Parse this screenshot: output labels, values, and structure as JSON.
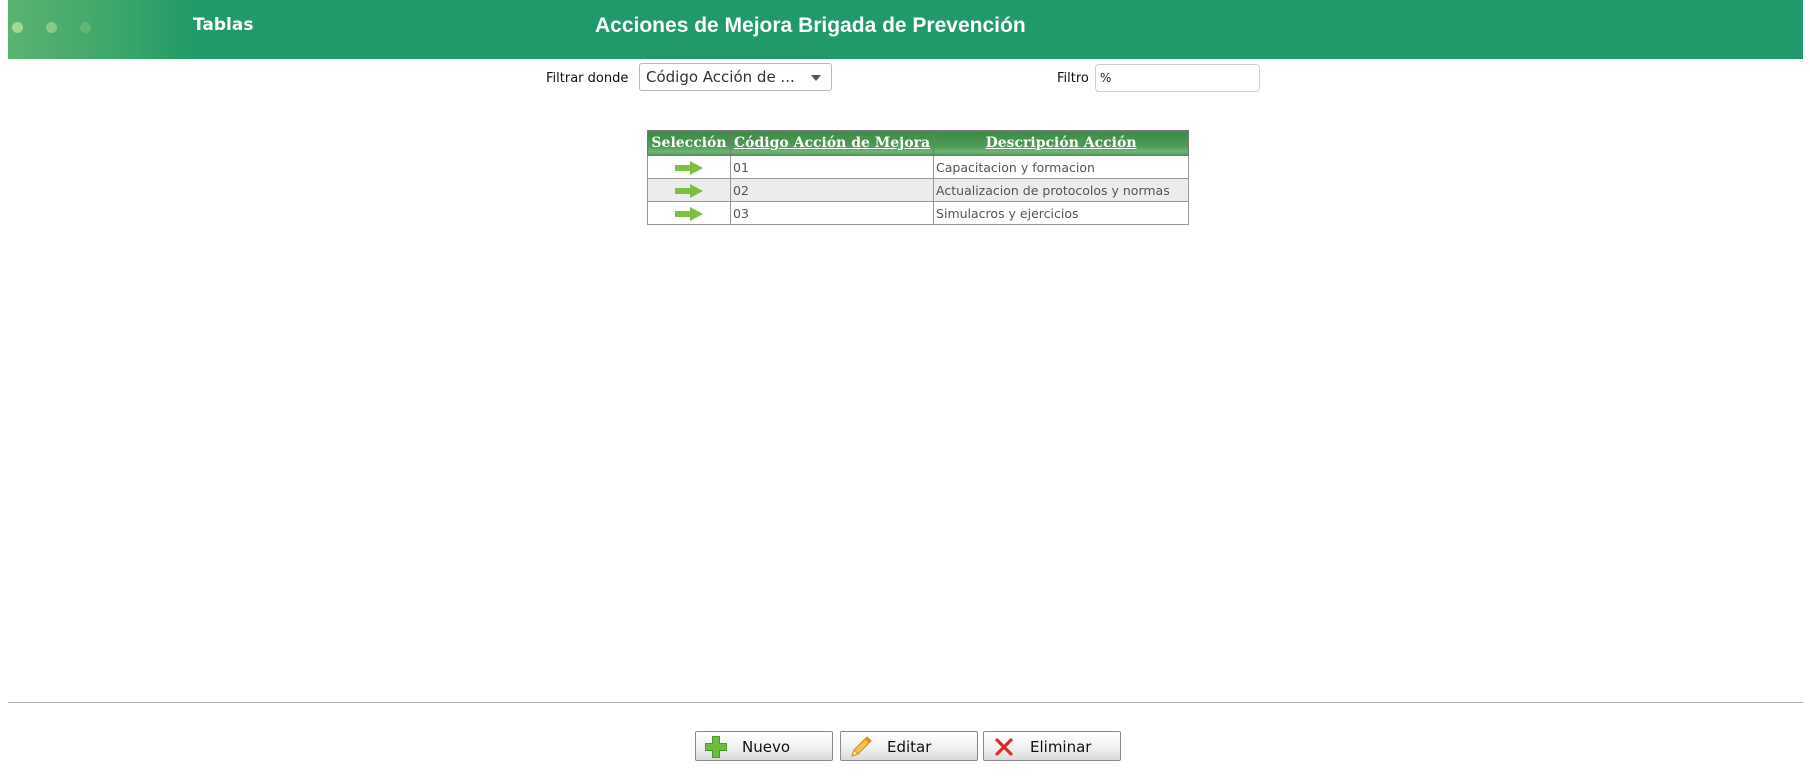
{
  "header": {
    "section": "Tablas",
    "title": "Acciones de Mejora Brigada de Prevención"
  },
  "filter": {
    "where_label": "Filtrar donde",
    "field_selected": "Código Acción de ...",
    "value_label": "Filtro",
    "value": "%"
  },
  "table": {
    "headers": {
      "select": "Selección",
      "code": "Código Acción de Mejora",
      "description": "Descripción Acción"
    },
    "rows": [
      {
        "code": "01",
        "description": "Capacitacion y formacion"
      },
      {
        "code": "02",
        "description": "Actualizacion de protocolos y normas"
      },
      {
        "code": "03",
        "description": "Simulacros y ejercicios"
      }
    ]
  },
  "buttons": {
    "new": "Nuevo",
    "edit": "Editar",
    "delete": "Eliminar"
  },
  "colors": {
    "header_bg": "#1f9a68",
    "table_header": "#4e9a57",
    "arrow": "#7bc043"
  }
}
